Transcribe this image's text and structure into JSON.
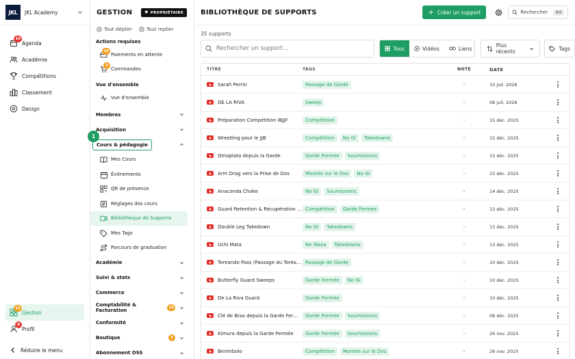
{
  "app": {
    "brand_logo": "JKL",
    "brand_name": "JKL Academy"
  },
  "nav": {
    "items": [
      {
        "label": "Agenda",
        "icon": "calendar-icon",
        "badge": "19"
      },
      {
        "label": "Académie",
        "icon": "users-icon",
        "badge": ""
      },
      {
        "label": "Compétitions",
        "icon": "trophy-icon",
        "badge": ""
      },
      {
        "label": "Classement",
        "icon": "ranking-icon",
        "badge": ""
      },
      {
        "label": "Design",
        "icon": "palette-icon",
        "badge": ""
      }
    ],
    "bottom": [
      {
        "label": "Gestion",
        "icon": "grid-icon",
        "badge": "13",
        "active": true
      },
      {
        "label": "Profil",
        "icon": "user-icon",
        "badge": "8",
        "active": false
      }
    ],
    "reduce_label": "Réduire le menu"
  },
  "gestion": {
    "title": "GESTION",
    "owner_label": "PROPRIÉTAIRE",
    "expand_all": "Tout déplier",
    "collapse_all": "Tout replier",
    "sections": [
      {
        "title": "Actions requises",
        "items": [
          {
            "label": "Paiements en attente",
            "badge": "10"
          },
          {
            "label": "Commandes",
            "badge": "2"
          }
        ]
      },
      {
        "title": "Vue d'ensemble",
        "items": [
          {
            "label": "Vue d'ensemble",
            "badge": ""
          }
        ]
      }
    ],
    "categories_top": [
      {
        "label": "Membres"
      },
      {
        "label": "Acquisition"
      }
    ],
    "cours": {
      "label": "Cours & pédagogie",
      "step": "1",
      "items": [
        {
          "label": "Mes Cours",
          "icon": "book-icon"
        },
        {
          "label": "Événements",
          "icon": "calendar-icon"
        },
        {
          "label": "QR de présence",
          "icon": "qr-icon"
        },
        {
          "label": "Réglages des cours",
          "icon": "settings-icon"
        },
        {
          "label": "Bibliothèque de Supports",
          "icon": "video-icon",
          "active": true
        },
        {
          "label": "Mes Tags",
          "icon": "tag-icon"
        },
        {
          "label": "Parcours de graduation",
          "icon": "route-icon"
        }
      ]
    },
    "categories_bottom": [
      {
        "label": "Académie",
        "badge": ""
      },
      {
        "label": "Suivi & stats",
        "badge": ""
      },
      {
        "label": "Commerce",
        "badge": ""
      },
      {
        "label": "Comptabilité & Facturation",
        "badge": "10"
      },
      {
        "label": "Conformité",
        "badge": ""
      },
      {
        "label": "Boutique",
        "badge": "2"
      },
      {
        "label": "Abonnement OSS",
        "badge": ""
      }
    ]
  },
  "main": {
    "title": "BIBLIOTHÈQUE DE SUPPORTS",
    "create_label": "Créer un support",
    "search_label": "Rechercher",
    "search_kbd": "⌘K",
    "count": "35 supports",
    "search_placeholder": "Rechercher un support...",
    "filters": [
      "Tous",
      "Vidéos",
      "Liens"
    ],
    "sort_label": "Plus récents",
    "tags_label": "Tags",
    "columns": [
      "TITRE",
      "TAGS",
      "NOTE",
      "DATE"
    ],
    "rows": [
      {
        "title": "Sarah Perrin",
        "tags": [
          "Passage de Garde"
        ],
        "note": "-",
        "date": "10 juil. 2026"
      },
      {
        "title": "DE LA RIVA",
        "tags": [
          "Sweep"
        ],
        "note": "-",
        "date": "08 juil. 2026"
      },
      {
        "title": "Préparation Compétition IBJJF",
        "tags": [
          "Compétition"
        ],
        "note": "-",
        "date": "15 déc. 2025"
      },
      {
        "title": "Wrestling pour le JJB",
        "tags": [
          "Compétition",
          "No Gi",
          "Takedowns"
        ],
        "note": "-",
        "date": "15 déc. 2025"
      },
      {
        "title": "Omoplata depuis la Garde",
        "tags": [
          "Garde Fermée",
          "Soumissions"
        ],
        "note": "-",
        "date": "15 déc. 2025"
      },
      {
        "title": "Arm Drag vers la Prise de Dos",
        "tags": [
          "Montée sur le Dos",
          "No Gi"
        ],
        "note": "-",
        "date": "15 déc. 2025"
      },
      {
        "title": "Anaconda Choke",
        "tags": [
          "No Gi",
          "Soumissions"
        ],
        "note": "-",
        "date": "14 déc. 2025"
      },
      {
        "title": "Guard Retention & Récupération de Garde",
        "tags": [
          "Compétition",
          "Garde Fermée"
        ],
        "note": "-",
        "date": "13 déc. 2025"
      },
      {
        "title": "Double Leg Takedown",
        "tags": [
          "No Gi",
          "Takedowns"
        ],
        "note": "-",
        "date": "13 déc. 2025"
      },
      {
        "title": "Uchi Mata",
        "tags": [
          "Ne Waza",
          "Takedowns"
        ],
        "note": "-",
        "date": "13 déc. 2025"
      },
      {
        "title": "Toreando Pass (Passage du Toréador)",
        "tags": [
          "Passage de Garde"
        ],
        "note": "-",
        "date": "10 déc. 2025"
      },
      {
        "title": "Butterfly Guard Sweeps",
        "tags": [
          "Garde Fermée",
          "No Gi"
        ],
        "note": "-",
        "date": "10 déc. 2025"
      },
      {
        "title": "De La Riva Guard",
        "tags": [
          "Garde Fermée"
        ],
        "note": "-",
        "date": "10 déc. 2025"
      },
      {
        "title": "Clé de Bras depuis la Garde Fermée",
        "tags": [
          "Garde Fermée",
          "Soumissions"
        ],
        "note": "-",
        "date": "06 déc. 2025"
      },
      {
        "title": "Kimura depuis la Garde Fermée",
        "tags": [
          "Garde Fermée",
          "Soumissions"
        ],
        "note": "-",
        "date": "26 nov. 2025"
      },
      {
        "title": "Berimbolo",
        "tags": [
          "Compétition",
          "Montée sur le Dos"
        ],
        "note": "-",
        "date": "26 nov. 2025"
      }
    ]
  },
  "colors": {
    "accent": "#1e9e63",
    "tag_bg": "#e2f4ea",
    "badge_red": "#e53935",
    "badge_orange": "#f0a020",
    "brand_dark": "#0d1b3d"
  }
}
